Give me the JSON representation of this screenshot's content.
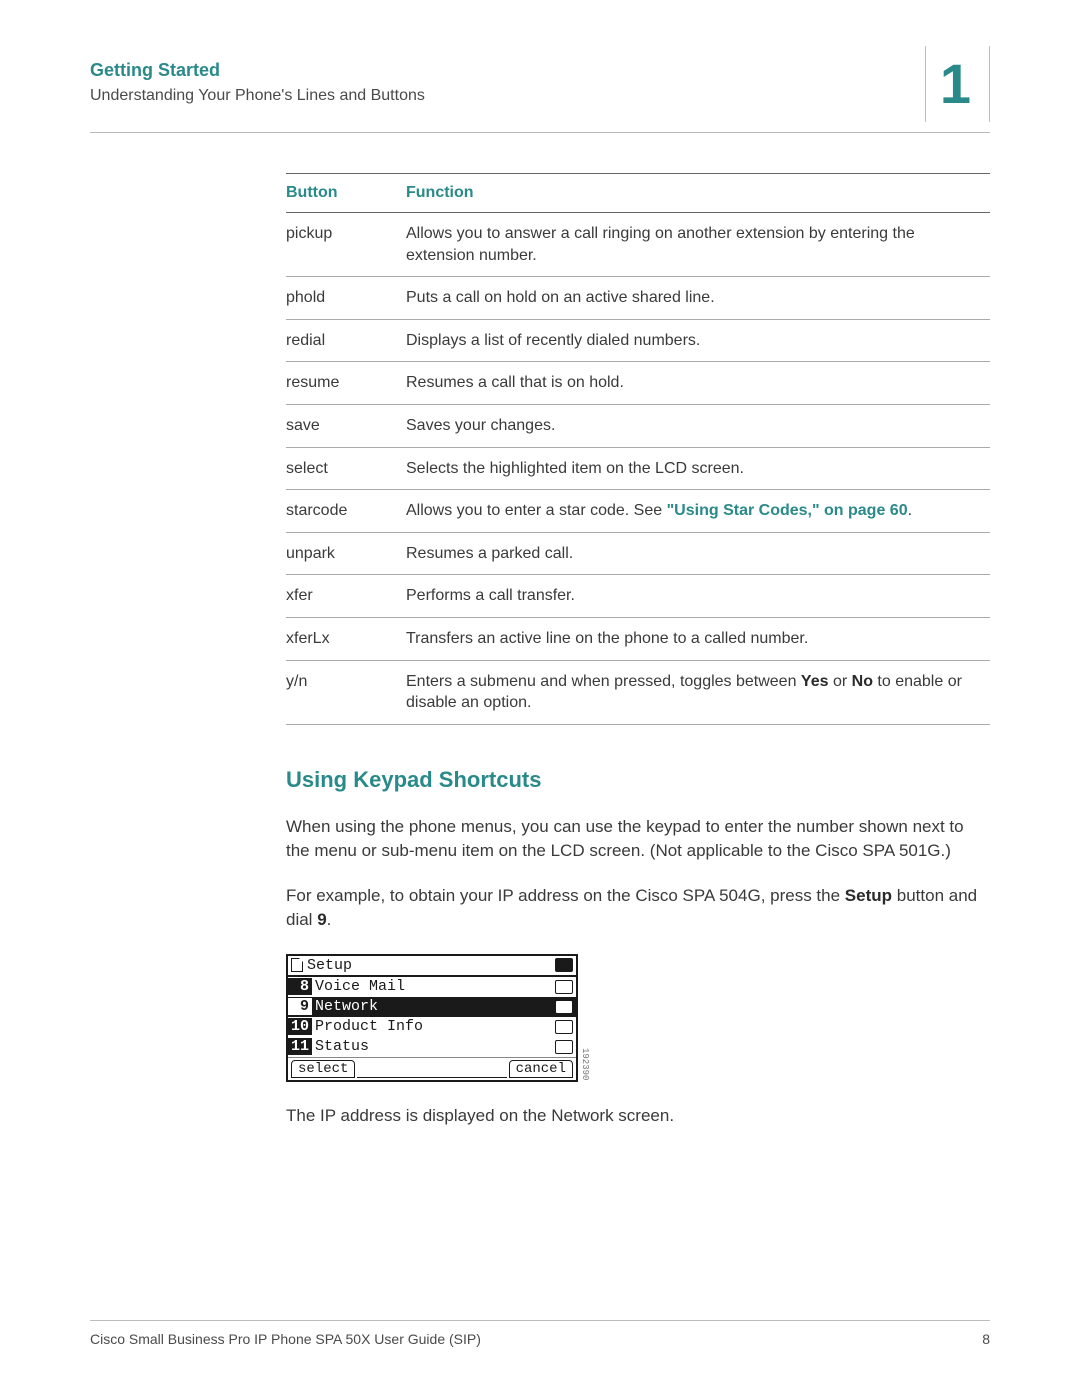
{
  "header": {
    "title": "Getting Started",
    "subtitle": "Understanding Your Phone's Lines and Buttons",
    "chapter_number": "1"
  },
  "table": {
    "col_button": "Button",
    "col_function": "Function",
    "rows": [
      {
        "button": "pickup",
        "function_pre": "Allows you to answer a call ringing on another extension by entering the extension number."
      },
      {
        "button": "phold",
        "function_pre": "Puts a call on hold on an active shared line."
      },
      {
        "button": "redial",
        "function_pre": "Displays a list of recently dialed numbers."
      },
      {
        "button": "resume",
        "function_pre": "Resumes a call that is on hold."
      },
      {
        "button": "save",
        "function_pre": "Saves your changes."
      },
      {
        "button": "select",
        "function_pre": "Selects the highlighted item on the LCD screen."
      },
      {
        "button": "starcode",
        "function_pre": "Allows you to enter a star code. See ",
        "link": "\"Using Star Codes,\" on page 60",
        "function_post": "."
      },
      {
        "button": "unpark",
        "function_pre": "Resumes a parked call."
      },
      {
        "button": "xfer",
        "function_pre": "Performs a call transfer."
      },
      {
        "button": "xferLx",
        "function_pre": "Transfers an active line on the phone to a called number."
      },
      {
        "button": "y/n",
        "function_pre": "Enters a submenu and when pressed, toggles between ",
        "bold1": "Yes",
        "mid": " or ",
        "bold2": "No",
        "function_post": " to enable or disable an option."
      }
    ]
  },
  "section": {
    "heading": "Using Keypad Shortcuts",
    "para1": "When using the phone menus, you can use the keypad to enter the number shown next to the menu or sub-menu item on the LCD screen. (Not applicable to the Cisco SPA 501G.)",
    "para2_pre": "For example, to obtain your IP address on the Cisco SPA 504G, press the ",
    "para2_bold": "Setup",
    "para2_mid": " button and dial ",
    "para2_bold2": "9",
    "para2_post": ".",
    "para3": "The IP address is displayed on the Network screen."
  },
  "lcd": {
    "title": "Setup",
    "rows": [
      {
        "num": "8",
        "label": "Voice Mail",
        "selected": false
      },
      {
        "num": "9",
        "label": "Network",
        "selected": true
      },
      {
        "num": "10",
        "label": "Product Info",
        "selected": false
      },
      {
        "num": "11",
        "label": "Status",
        "selected": false
      }
    ],
    "soft_left": "select",
    "soft_right": "cancel",
    "side_text": "192390"
  },
  "footer": {
    "left": "Cisco Small Business Pro IP Phone SPA 50X User Guide (SIP)",
    "right": "8"
  }
}
